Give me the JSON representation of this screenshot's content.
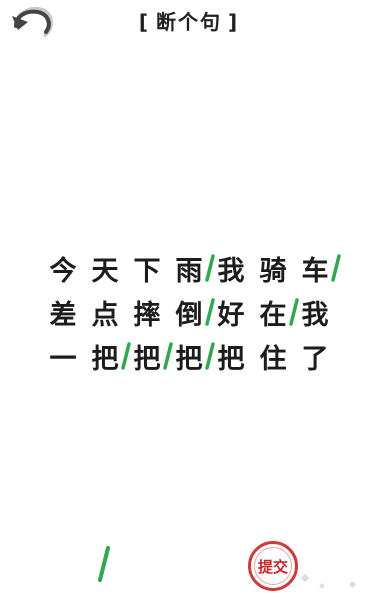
{
  "header": {
    "title": "断个句",
    "bracket_left": "[",
    "bracket_right": "]"
  },
  "icons": {
    "back": "back-arrow-icon",
    "divider": "slash-divider-icon"
  },
  "colors": {
    "slash": "#2fa84f",
    "submit_ring": "#cf3b3b",
    "text": "#1c1c1c"
  },
  "sentence": {
    "rows": [
      [
        {
          "char": "今",
          "slash": false
        },
        {
          "char": "天",
          "slash": false
        },
        {
          "char": "下",
          "slash": false
        },
        {
          "char": "雨",
          "slash": true
        },
        {
          "char": "我",
          "slash": false
        },
        {
          "char": "骑",
          "slash": false
        },
        {
          "char": "车",
          "slash": true
        }
      ],
      [
        {
          "char": "差",
          "slash": false
        },
        {
          "char": "点",
          "slash": false
        },
        {
          "char": "摔",
          "slash": false
        },
        {
          "char": "倒",
          "slash": true
        },
        {
          "char": "好",
          "slash": false
        },
        {
          "char": "在",
          "slash": true
        },
        {
          "char": "我",
          "slash": false
        }
      ],
      [
        {
          "char": "一",
          "slash": false
        },
        {
          "char": "把",
          "slash": true
        },
        {
          "char": "把",
          "slash": true
        },
        {
          "char": "把",
          "slash": true
        },
        {
          "char": "把",
          "slash": false
        },
        {
          "char": "住",
          "slash": false
        },
        {
          "char": "了",
          "slash": false
        }
      ]
    ]
  },
  "footer": {
    "submit_label": "提交"
  }
}
